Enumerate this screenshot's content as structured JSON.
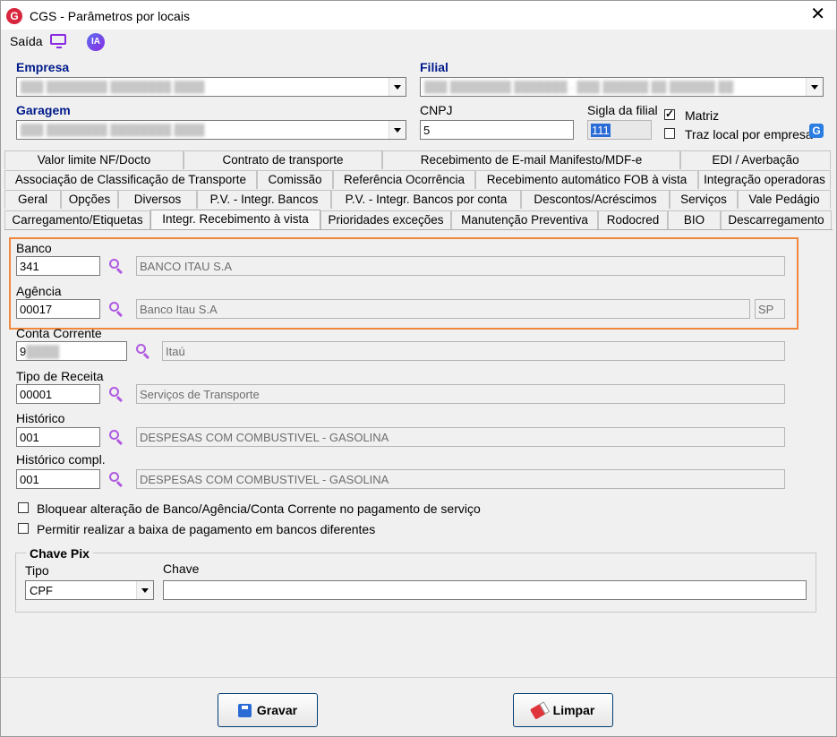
{
  "window": {
    "title": "CGS - Parâmetros por locais",
    "logo_letter": "G"
  },
  "menu": {
    "exit_label": "Saída",
    "ia_label": "IA"
  },
  "fields": {
    "empresa_label": "Empresa",
    "filial_label": "Filial",
    "garagem_label": "Garagem",
    "cnpj_label": "CNPJ",
    "cnpj_value": "5",
    "sigla_label": "Sigla da filial",
    "sigla_value": "111",
    "matriz_label": "Matriz",
    "traz_local_label": "Traz local por empresa"
  },
  "tabs": {
    "row1": [
      "Valor limite NF/Docto",
      "Contrato de transporte",
      "Recebimento de E-mail Manifesto/MDF-e",
      "EDI / Averbação"
    ],
    "row2": [
      "Associação de Classificação de Transporte",
      "Comissão",
      "Referência Ocorrência",
      "Recebimento automático FOB à vista",
      "Integração operadoras"
    ],
    "row3": [
      "Geral",
      "Opções",
      "Diversos",
      "P.V. - Integr. Bancos",
      "P.V. - Integr. Bancos por conta",
      "Descontos/Acréscimos",
      "Serviços",
      "Vale Pedágio"
    ],
    "row4": [
      "Carregamento/Etiquetas",
      "Integr. Recebimento à vista",
      "Prioridades exceções",
      "Manutenção Preventiva",
      "Rodocred",
      "BIO",
      "Descarregamento"
    ]
  },
  "form": {
    "banco_label": "Banco",
    "banco_code": "341",
    "banco_name": "BANCO ITAU S.A",
    "agencia_label": "Agência",
    "agencia_code": "00017",
    "agencia_name": "Banco Itau S.A",
    "agencia_uf": "SP",
    "conta_label": "Conta Corrente",
    "conta_code": "9",
    "conta_name": "Itaú",
    "tipo_receita_label": "Tipo de Receita",
    "tipo_receita_code": "00001",
    "tipo_receita_name": "Serviços de Transporte",
    "historico_label": "Histórico",
    "historico_code": "001",
    "historico_name": "DESPESAS COM COMBUSTIVEL - GASOLINA",
    "historico_compl_label": "Histórico compl.",
    "historico_compl_code": "001",
    "historico_compl_name": "DESPESAS COM COMBUSTIVEL - GASOLINA",
    "bloquear_label": "Bloquear alteração de Banco/Agência/Conta Corrente no pagamento de serviço",
    "permitir_label": "Permitir realizar a baixa de pagamento em bancos diferentes"
  },
  "pix": {
    "title": "Chave Pix",
    "tipo_label": "Tipo",
    "tipo_value": "CPF",
    "chave_label": "Chave",
    "chave_value": ""
  },
  "buttons": {
    "save_label": "Gravar",
    "clear_label": "Limpar"
  },
  "colors": {
    "accent_label": "#001a8a",
    "highlight_border": "#f0883c",
    "search_icon": "#b05be0"
  }
}
